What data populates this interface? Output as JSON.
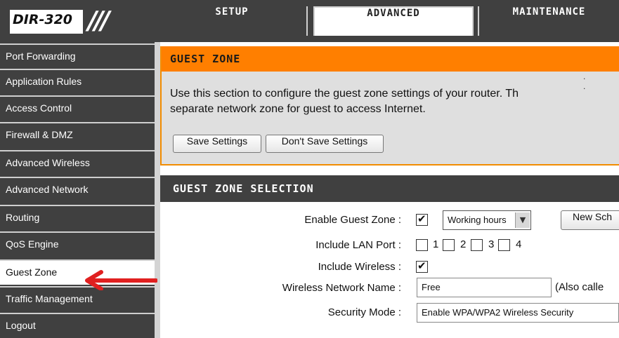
{
  "header": {
    "model": "DIR-320",
    "tabs": [
      {
        "label": "SETUP",
        "active": false
      },
      {
        "label": "ADVANCED",
        "active": true
      },
      {
        "label": "MAINTENANCE",
        "active": false
      }
    ]
  },
  "sidebar": {
    "items": [
      {
        "label": "Port Forwarding",
        "active": false
      },
      {
        "label": "Application Rules",
        "active": false
      },
      {
        "label": "Access Control",
        "active": false
      },
      {
        "label": "Firewall & DMZ",
        "active": false
      },
      {
        "label": "Advanced Wireless",
        "active": false
      },
      {
        "label": "Advanced Network",
        "active": false
      },
      {
        "label": "Routing",
        "active": false
      },
      {
        "label": "QoS Engine",
        "active": false
      },
      {
        "label": "Guest Zone",
        "active": true
      },
      {
        "label": "Traffic Management",
        "active": false
      },
      {
        "label": "Logout",
        "active": false
      }
    ]
  },
  "guest_zone": {
    "title": "GUEST ZONE",
    "dots": ". .",
    "description_line1": "Use this section to configure the guest zone settings of your router. Th",
    "description_line2": "separate network zone for guest to access Internet.",
    "save_label": "Save Settings",
    "dont_save_label": "Don't Save Settings"
  },
  "selection": {
    "title": "GUEST ZONE SELECTION",
    "enable_label": "Enable Guest Zone :",
    "enable_checked": true,
    "schedule_value": "Working hours",
    "new_schedule_label": "New Sch",
    "lan_label": "Include LAN Port :",
    "lan_ports": [
      "1",
      "2",
      "3",
      "4"
    ],
    "wireless_label": "Include Wireless :",
    "wireless_checked": true,
    "ssid_label": "Wireless Network Name :",
    "ssid_value": "Free",
    "ssid_note": "(Also calle",
    "security_label": "Security Mode :",
    "security_value": "Enable WPA/WPA2 Wireless Security"
  },
  "colors": {
    "dark_gray": "#404040",
    "orange": "#ff7f00",
    "panel_gray": "#dfdfdf",
    "arrow_red": "#e02020"
  }
}
